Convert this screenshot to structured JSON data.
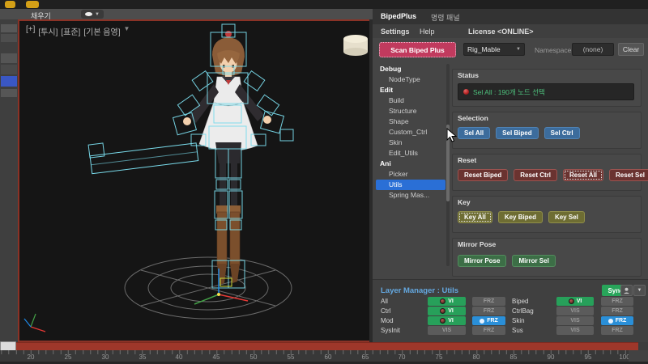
{
  "top_bar": {
    "menu_item": "채우기"
  },
  "viewport": {
    "labels": {
      "plus": "[+]",
      "view": "[투시]",
      "style": "[표준]",
      "shading": "[기본 음영]"
    }
  },
  "panel": {
    "tabs": [
      {
        "label": "BipedPlus"
      },
      {
        "label": "명령 패널"
      }
    ],
    "menu": {
      "settings": "Settings",
      "help": "Help",
      "license": "License <ONLINE>"
    },
    "toolbar": {
      "scan": "Scan Biped Plus",
      "rig": "Rig_Mable",
      "namespace_label": "Namespace:",
      "namespace_value": "(none)",
      "clear": "Clear"
    },
    "tree": {
      "items": [
        {
          "label": "Debug"
        },
        {
          "label": "NodeType"
        },
        {
          "label": "Edit"
        },
        {
          "label": "Build"
        },
        {
          "label": "Structure"
        },
        {
          "label": "Shape"
        },
        {
          "label": "Custom_Ctrl"
        },
        {
          "label": "Skin"
        },
        {
          "label": "Edit_Utils"
        },
        {
          "label": "Ani"
        },
        {
          "label": "Picker"
        },
        {
          "label": "Utils"
        },
        {
          "label": "Spring Mas..."
        }
      ]
    },
    "groups": {
      "status": {
        "title": "Status",
        "message": "Sel All : 190개 노드 선택"
      },
      "selection": {
        "title": "Selection",
        "buttons": [
          "Sel All",
          "Sel Biped",
          "Sel Ctrl"
        ]
      },
      "reset": {
        "title": "Reset",
        "buttons": [
          "Reset Biped",
          "Reset Ctrl",
          "Reset All",
          "Reset Sel"
        ]
      },
      "key": {
        "title": "Key",
        "buttons": [
          "Key All",
          "Key Biped",
          "Key Sel"
        ]
      },
      "mirror": {
        "title": "Mirror Pose",
        "buttons": [
          "Mirror Pose",
          "Mirror Sel"
        ]
      }
    }
  },
  "layer_manager": {
    "title": "Layer Manager : Utils",
    "sync": "Sync",
    "rows": [
      {
        "name": "All",
        "vis": "VI",
        "frz": "FRZ",
        "name2": "Biped",
        "vis2": "VI",
        "frz2": "FRZ"
      },
      {
        "name": "Ctrl",
        "vis": "VI",
        "frz": "FRZ",
        "name2": "CtrlBag",
        "vis2": "VIS",
        "frz2": "FRZ"
      },
      {
        "name": "Mod",
        "vis": "VI",
        "frz": "FRZ",
        "name2": "Skin",
        "vis2": "VIS",
        "frz2": "FRZ"
      },
      {
        "name": "SysInit",
        "vis": "VIS",
        "frz": "FRZ",
        "name2": "Sus",
        "vis2": "VIS",
        "frz2": "FRZ"
      }
    ]
  },
  "timeline": {
    "labels": [
      "20",
      "25",
      "30",
      "35",
      "40",
      "45",
      "50",
      "55",
      "60",
      "65",
      "70",
      "75",
      "80",
      "85",
      "90",
      "95",
      "100"
    ]
  },
  "colors": {
    "scan_red": "#c13a5e",
    "selection_blue": "#2a6fd6",
    "button_blue": "#3c6c9c",
    "button_red": "#6a3330",
    "button_olive": "#6e6d33",
    "button_green": "#3c6e46",
    "layer_green": "#27a05a",
    "layer_blue": "#2a8fd8",
    "sync_green": "#28a55a",
    "status_green": "#4ec27d",
    "wireframe_cyan": "#7adcec",
    "viewport_border": "#8a3226"
  }
}
